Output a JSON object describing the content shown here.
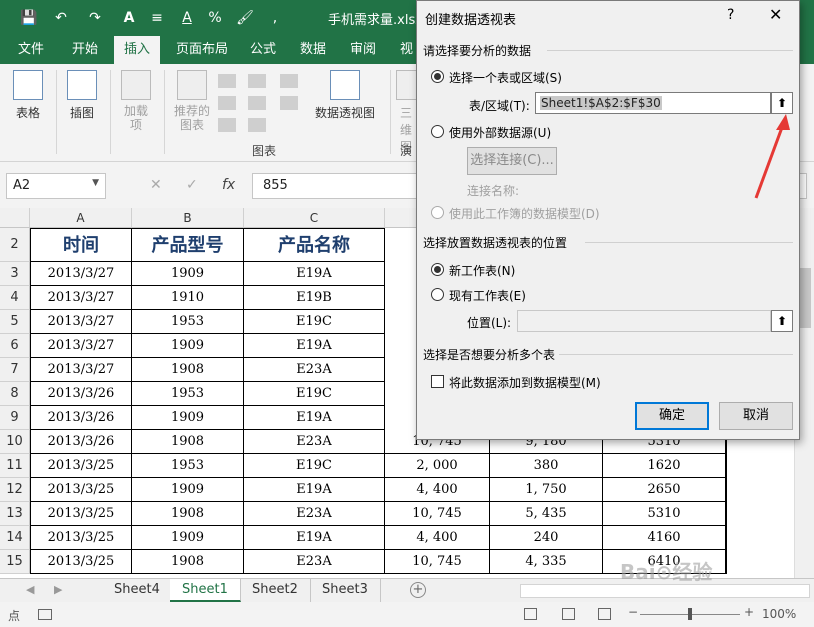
{
  "window": {
    "file_title": "手机需求量.xlsx"
  },
  "qat": {
    "save": "💾",
    "undo": "↶",
    "redo": "↷",
    "format_painter": "A",
    "lines": "≡",
    "font_color": "A",
    "percent": "%",
    "brush": "🖌",
    "comma": ","
  },
  "tabs": [
    "文件",
    "开始",
    "插入",
    "页面布局",
    "公式",
    "数据",
    "审阅",
    "视"
  ],
  "ribbon": {
    "table_label": "表格",
    "illustration_label": "插图",
    "addin_label": "加载项",
    "recommended_label": "推荐的图表",
    "pivot_chart_label": "数据透视图",
    "three_d_label": "三维图",
    "chart_group_label": "图表",
    "tour_group_label": "演"
  },
  "formula_bar": {
    "name_box": "A2",
    "cancel": "✕",
    "enter": "✓",
    "fx": "fx",
    "value": "855"
  },
  "columns": [
    "A",
    "B",
    "C"
  ],
  "table": {
    "headers": [
      "时间",
      "产品型号",
      "产品名称"
    ],
    "rows": [
      {
        "num": "3",
        "cells": [
          "2013/3/27",
          "1909",
          "E19A"
        ]
      },
      {
        "num": "4",
        "cells": [
          "2013/3/27",
          "1910",
          "E19B"
        ]
      },
      {
        "num": "5",
        "cells": [
          "2013/3/27",
          "1953",
          "E19C"
        ]
      },
      {
        "num": "6",
        "cells": [
          "2013/3/27",
          "1909",
          "E19A"
        ]
      },
      {
        "num": "7",
        "cells": [
          "2013/3/27",
          "1908",
          "E23A"
        ]
      },
      {
        "num": "8",
        "cells": [
          "2013/3/26",
          "1953",
          "E19C"
        ]
      },
      {
        "num": "9",
        "cells": [
          "2013/3/26",
          "1909",
          "E19A"
        ]
      },
      {
        "num": "10",
        "cells": [
          "2013/3/26",
          "1908",
          "E23A",
          "10, 745",
          "9, 180",
          "5310"
        ]
      },
      {
        "num": "11",
        "cells": [
          "2013/3/25",
          "1953",
          "E19C",
          "2, 000",
          "380",
          "1620"
        ]
      },
      {
        "num": "12",
        "cells": [
          "2013/3/25",
          "1909",
          "E19A",
          "4, 400",
          "1, 750",
          "2650"
        ]
      },
      {
        "num": "13",
        "cells": [
          "2013/3/25",
          "1908",
          "E23A",
          "10, 745",
          "5, 435",
          "5310"
        ]
      },
      {
        "num": "14",
        "cells": [
          "2013/3/25",
          "1909",
          "E19A",
          "4, 400",
          "240",
          "4160"
        ]
      },
      {
        "num": "15",
        "cells": [
          "2013/3/25",
          "1908",
          "E23A",
          "10, 745",
          "4, 335",
          "6410"
        ]
      }
    ]
  },
  "header_row_num": "2",
  "sheets": [
    "Sheet4",
    "Sheet1",
    "Sheet2",
    "Sheet3"
  ],
  "active_sheet": "Sheet1",
  "add_sheet": "+",
  "status": {
    "ready": "点",
    "zoom": "100%"
  },
  "dialog": {
    "title": "创建数据透视表",
    "help": "?",
    "close": "✕",
    "section1": "请选择要分析的数据",
    "opt_select_range": "选择一个表或区域(S)",
    "range_label": "表/区域(T):",
    "range_value": "Sheet1!$A$2:$F$30",
    "opt_external": "使用外部数据源(U)",
    "choose_connection": "选择连接(C)...",
    "connection_name": "连接名称:",
    "opt_data_model": "使用此工作簿的数据模型(D)",
    "section2": "选择放置数据透视表的位置",
    "opt_new_sheet": "新工作表(N)",
    "opt_existing_sheet": "现有工作表(E)",
    "location_label": "位置(L):",
    "section3": "选择是否想要分析多个表",
    "add_to_model": "将此数据添加到数据模型(M)",
    "ok": "确定",
    "cancel": "取消",
    "collapse_glyph": "⬆"
  },
  "colors": {
    "excel_green": "#217346",
    "annotation_red": "#e53935",
    "dialog_bg": "#f0f0f0"
  }
}
